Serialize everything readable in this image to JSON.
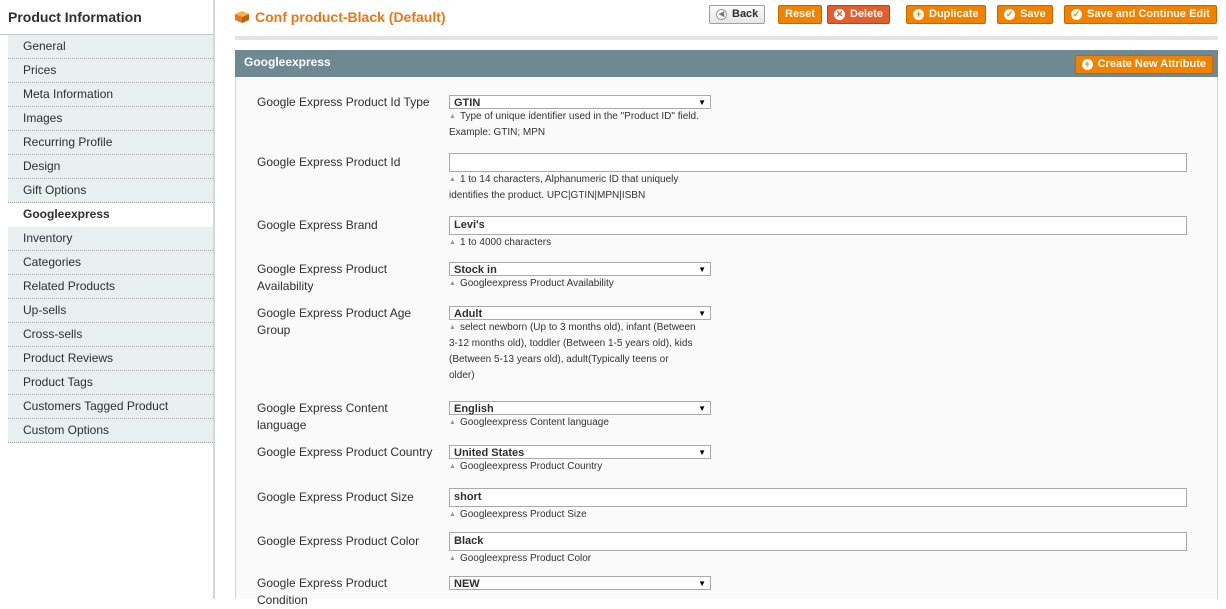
{
  "sidebar": {
    "title": "Product Information",
    "items": [
      {
        "label": "General"
      },
      {
        "label": "Prices"
      },
      {
        "label": "Meta Information"
      },
      {
        "label": "Images"
      },
      {
        "label": "Recurring Profile"
      },
      {
        "label": "Design"
      },
      {
        "label": "Gift Options"
      },
      {
        "label": "Googleexpress",
        "active": true
      },
      {
        "label": "Inventory"
      },
      {
        "label": "Categories"
      },
      {
        "label": "Related Products"
      },
      {
        "label": "Up-sells"
      },
      {
        "label": "Cross-sells"
      },
      {
        "label": "Product Reviews"
      },
      {
        "label": "Product Tags"
      },
      {
        "label": "Customers Tagged Product"
      },
      {
        "label": "Custom Options"
      }
    ]
  },
  "header": {
    "title": "Conf product-Black (Default)",
    "buttons": {
      "back": "Back",
      "reset": "Reset",
      "delete": "Delete",
      "duplicate": "Duplicate",
      "save": "Save",
      "save_continue": "Save and Continue Edit"
    }
  },
  "section": {
    "title": "Googleexpress",
    "create_button": "Create New Attribute"
  },
  "fields": [
    {
      "label": "Google Express Product Id Type",
      "type": "select",
      "value": "GTIN",
      "note": [
        "Type of unique identifier used in the \"Product ID\" field.",
        "Example: GTIN; MPN"
      ]
    },
    {
      "label": "Google Express Product Id",
      "type": "input",
      "value": "",
      "note": [
        "1 to 14 characters, Alphanumeric ID that uniquely",
        "identifies the product. UPC|GTIN|MPN|ISBN"
      ]
    },
    {
      "label": "Google Express Brand",
      "type": "input",
      "value": "Levi's",
      "note": [
        "1 to 4000 characters"
      ]
    },
    {
      "label": "Google Express Product Availability",
      "type": "select",
      "value": "Stock in",
      "note": [
        "Googleexpress Product Availability"
      ]
    },
    {
      "label": "Google Express Product Age Group",
      "type": "select",
      "value": "Adult",
      "note": [
        "select newborn (Up to 3 months old), infant (Between",
        "3-12 months old), toddler (Between 1-5 years old), kids",
        "(Between 5-13 years old), adult(Typically teens or",
        "older)"
      ]
    },
    {
      "label": "Google Express Content language",
      "type": "select",
      "value": "English",
      "note": [
        "Googleexpress Content language"
      ]
    },
    {
      "label": "Google Express Product Country",
      "type": "select",
      "value": "United States",
      "note": [
        "Googleexpress Product Country"
      ]
    },
    {
      "label": "Google Express Product Size",
      "type": "input",
      "value": "short",
      "note": [
        "Googleexpress Product Size"
      ]
    },
    {
      "label": "Google Express Product Color",
      "type": "input",
      "value": "Black",
      "note": [
        "Googleexpress Product Color"
      ]
    },
    {
      "label": "Google Express Product Condition",
      "type": "select",
      "value": "NEW",
      "note": []
    }
  ],
  "icons": {
    "back": "back-arrow-icon",
    "delete": "delete-x-icon",
    "plus": "plus-icon",
    "save": "check-icon",
    "title": "cube-icon",
    "note": "triangle-up-icon",
    "select": "dropdown-arrow-icon"
  },
  "colors": {
    "accent": "#f18200",
    "title": "#e67817",
    "section_header": "#6f8992",
    "delete": "#e25e2c"
  }
}
